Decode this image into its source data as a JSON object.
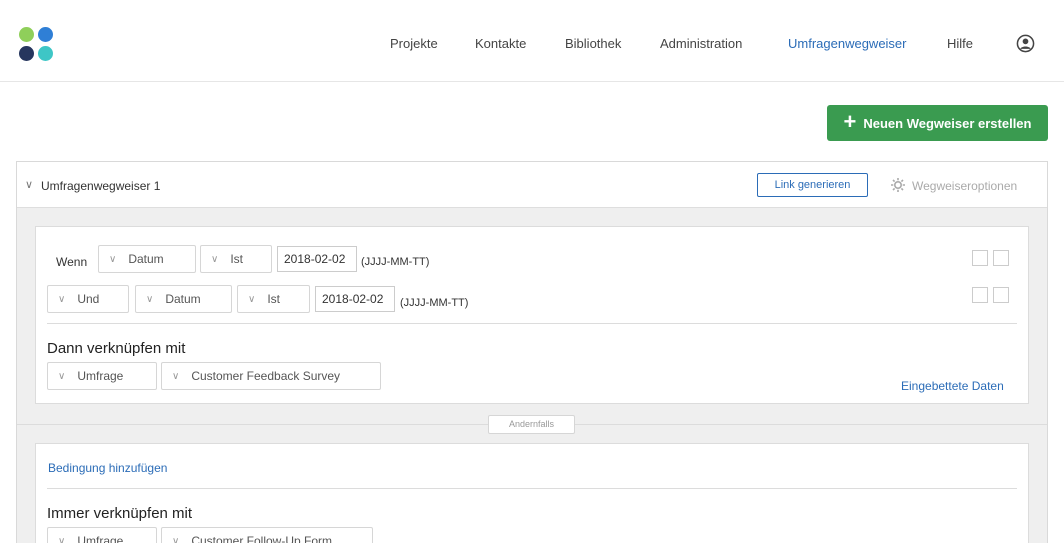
{
  "nav": {
    "items": [
      "Projekte",
      "Kontakte",
      "Bibliothek",
      "Administration",
      "Umfragenwegweiser",
      "Hilfe"
    ],
    "active": "Umfragenwegweiser"
  },
  "toolbar": {
    "create_label": "Neuen Wegweiser erstellen"
  },
  "card": {
    "title": "Umfragenwegweiser 1",
    "link_button": "Link generieren",
    "options_label": "Wegweiseroptionen"
  },
  "conditions": {
    "row1": {
      "prefix": "Wenn",
      "field": "Datum",
      "operator": "Ist",
      "value": "2018-02-02",
      "format": "(JJJJ-MM-TT)"
    },
    "row2": {
      "conjunction": "Und",
      "field": "Datum",
      "operator": "Ist",
      "value": "2018-02-02",
      "format": "(JJJJ-MM-TT)"
    }
  },
  "then": {
    "title": "Dann verknüpfen mit",
    "type": "Umfrage",
    "target": "Customer Feedback Survey",
    "embedded_link": "Eingebettete Daten"
  },
  "otherwise_label": "Andernfalls",
  "fallback": {
    "add_condition": "Bedingung hinzufügen",
    "title": "Immer verknüpfen mit",
    "type": "Umfrage",
    "target": "Customer Follow-Up Form"
  },
  "colors": {
    "accent": "#2b6cb7",
    "create_button": "#3a9b50"
  }
}
